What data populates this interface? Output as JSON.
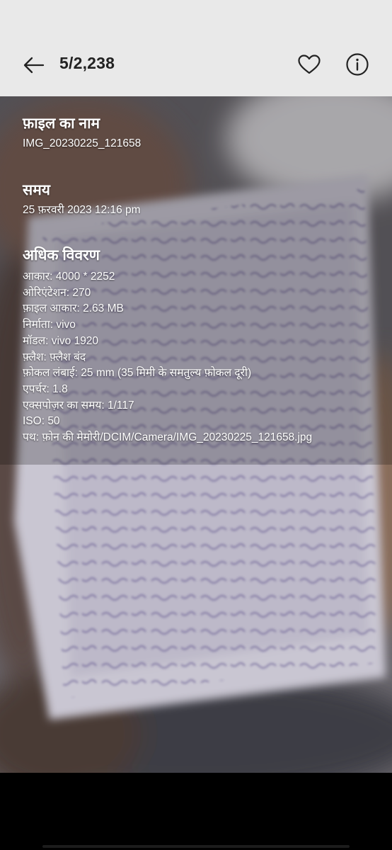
{
  "header": {
    "counter": "5/2,238",
    "back_icon": "arrow-left-icon",
    "favorite_icon": "heart-outline-icon",
    "info_icon": "info-circle-icon"
  },
  "details": {
    "file_name_title": "फ़ाइल का नाम",
    "file_name_value": "IMG_20230225_121658",
    "time_title": "समय",
    "time_value": "25 फ़रवरी 2023 12:16 pm",
    "advanced_title": "अधिक विवरण",
    "items": [
      "आकार: 4000 * 2252",
      "ओरिएंटेशन: 270",
      "फ़ाइल आकार: 2.63 MB",
      "निर्माता: vivo",
      "मॉडल: vivo 1920",
      "फ़्लैश: फ़्लैश बंद",
      "फ़ोकल लंबाई: 25 mm (35 मिमी के समतुल्य फ़ोकल दूरी)",
      "एपर्चर: 1.8",
      "एक्सपोज़र का समय: 1/117",
      "ISO: 50",
      "पथ: फ़ोन की मेमोरी/DCIM/Camera/IMG_20230225_121658.jpg"
    ]
  },
  "colors": {
    "header_bg": "#e9e9e9",
    "icon_color": "#222222",
    "overlay_text": "#ffffff",
    "page_bg": "#000000"
  }
}
